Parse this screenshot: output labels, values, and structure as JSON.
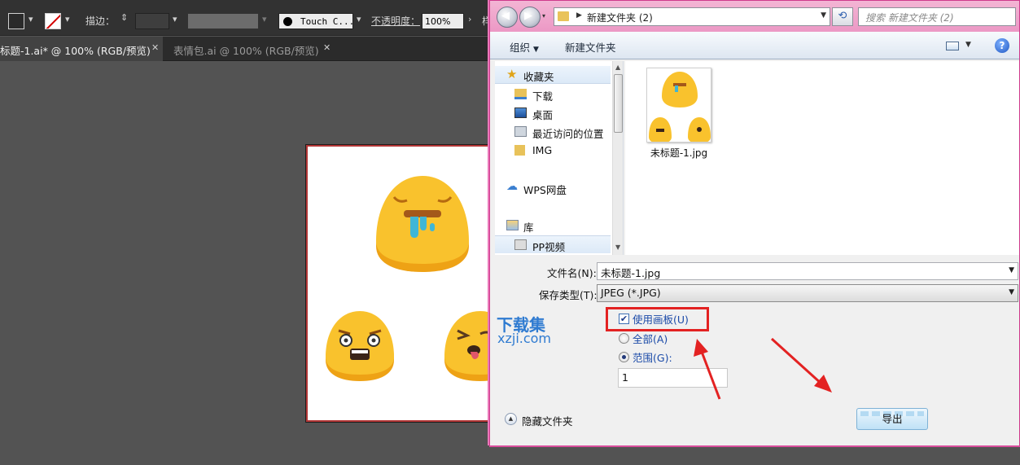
{
  "toolbar": {
    "stroke_label": "描边：",
    "brush_label": "Touch C...",
    "opacity_label": "不透明度：",
    "opacity_value": "100%",
    "cut_label": "样"
  },
  "doc_tabs": [
    {
      "label": "标题-1.ai* @ 100% (RGB/预览)",
      "active": true
    },
    {
      "label": "表情包.ai @ 100% (RGB/预览)",
      "active": false
    }
  ],
  "dialog": {
    "address": "新建文件夹 (2)",
    "search_placeholder": "搜索 新建文件夹 (2)",
    "commands": {
      "organize": "组织",
      "new_folder": "新建文件夹"
    },
    "nav": {
      "favorites": "收藏夹",
      "downloads": "下载",
      "desktop": "桌面",
      "recent": "最近访问的位置",
      "img": "IMG",
      "wps": "WPS网盘",
      "library": "库",
      "pp_video": "PP视频"
    },
    "file": {
      "name": "未标题-1.jpg"
    },
    "form": {
      "filename_label": "文件名(N):",
      "filename_value": "未标题-1.jpg",
      "filetype_label": "保存类型(T):",
      "filetype_value": "JPEG (*.JPG)",
      "use_artboard": "使用画板(U)",
      "all": "全部(A)",
      "range": "范围(G):",
      "range_value": "1",
      "hide_folders": "隐藏文件夹",
      "export": "导出"
    }
  },
  "watermark": {
    "cn": "下载集",
    "en": "xzji.com"
  },
  "colors": {
    "emoji_yellow": "#f9c22d",
    "emoji_shadow": "#eea215",
    "drool_blue": "#3fb6d6",
    "highlight_red": "#e32222",
    "dialog_frame": "#ec98c5"
  }
}
